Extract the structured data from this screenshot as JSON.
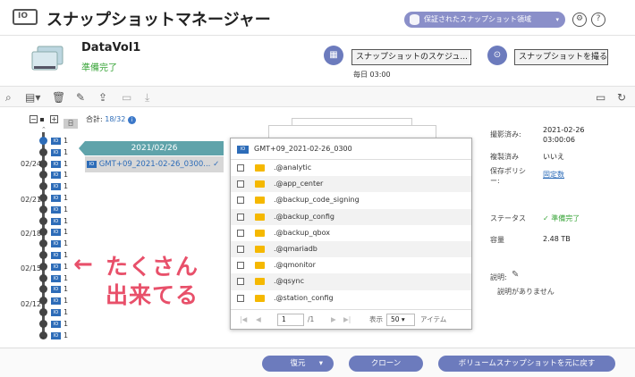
{
  "app": {
    "title": "スナップショットマネージャー",
    "icon_text": "IO"
  },
  "header": {
    "protected_region_label": "保証されたスナップショット領域",
    "dropdown_caret": "▾",
    "settings_icon": "gear-icon",
    "help_icon": "question-icon",
    "help_glyph": "?"
  },
  "volume": {
    "name": "DataVol1",
    "status": "準備完了",
    "schedule_button": "スナップショットのスケジュ...",
    "schedule_time": "毎日 03:00",
    "take_snapshot_button": "スナップショットを撮る"
  },
  "timeline": {
    "total_label": "合計:",
    "total_value": "18/32",
    "collapse": "−",
    "expand": "+",
    "day_badge": "日",
    "row_text": "1",
    "row_icon": "IO",
    "dates": [
      "02/24",
      "02/21",
      "02/18",
      "02/15",
      "02/12"
    ],
    "scroll_down": "⌄"
  },
  "snapshot_panel": {
    "date": "2021/02/26",
    "item_label": "GMT+09_2021-02-26_0300...",
    "check": "✓"
  },
  "file_window": {
    "title": "GMT+09_2021-02-26_0300",
    "folders": [
      ".@analytic",
      ".@app_center",
      ".@backup_code_signing",
      ".@backup_config",
      ".@backup_qbox",
      ".@qmariadb",
      ".@qmonitor",
      ".@qsync",
      ".@station_config"
    ],
    "pager": {
      "page": "1",
      "total": "/1",
      "show_label": "表示",
      "per_page": "50",
      "unit": "アイテム"
    }
  },
  "info": {
    "taken_label": "撮影済み:",
    "taken_value_date": "2021-02-26",
    "taken_value_time": "03:00:06",
    "copied_label": "複製済み",
    "copied_value": "いいえ",
    "retention_label": "保存ポリシー:",
    "retention_value": "固定数",
    "status_label": "ステータス",
    "status_value": "準備完了",
    "capacity_label": "容量",
    "capacity_value": "2.48 TB",
    "description_label": "説明:",
    "description_value": "説明がありません"
  },
  "buttons": {
    "restore": "復元",
    "clone": "クローン",
    "revert": "ボリュームスナップショットを元に戻す"
  },
  "annotation": {
    "line1": "たくさん",
    "line2": "出来てる",
    "arrow": "←"
  },
  "colors": {
    "accent": "#6c7bbd",
    "panel_teal": "#5fa3aa",
    "ok_green": "#3aa53a",
    "annotation_pink": "#e8506a"
  }
}
